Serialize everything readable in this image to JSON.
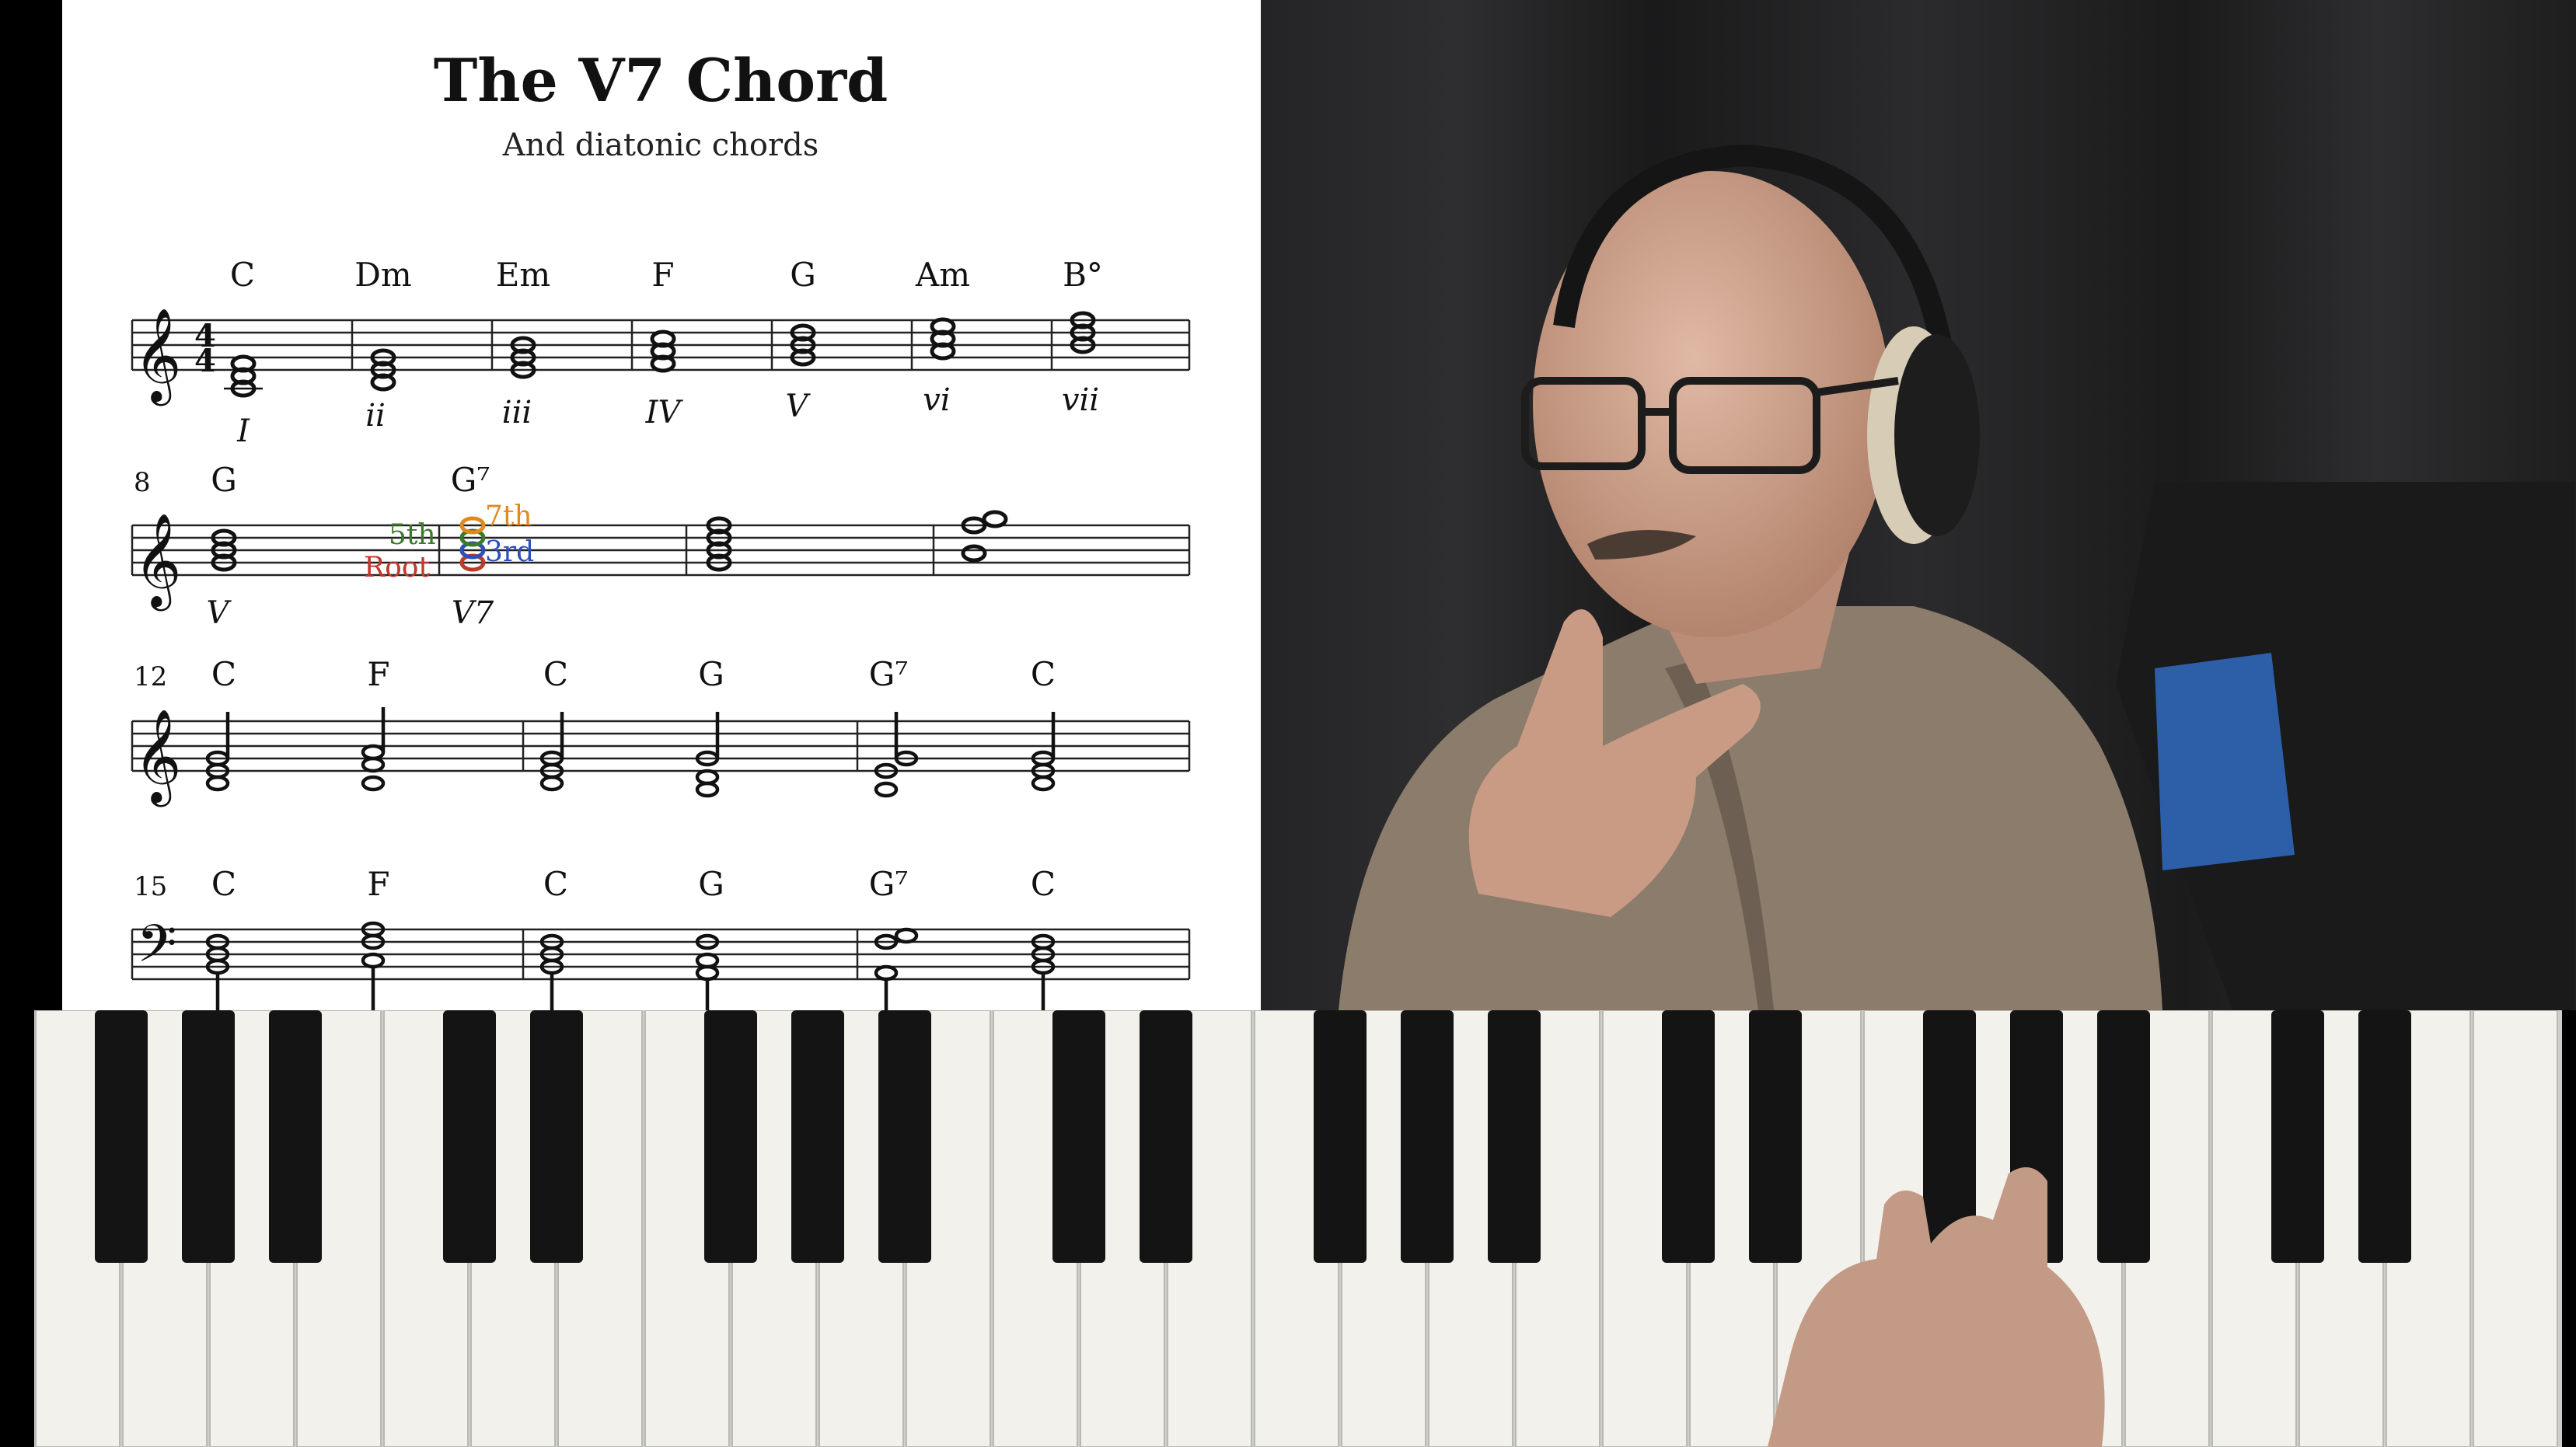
{
  "score": {
    "title": "The V7 Chord",
    "subtitle": "And diatonic chords",
    "systems": [
      {
        "measure_number": "",
        "clef": "treble",
        "time_signature": "4/4",
        "chords": [
          "C",
          "Dm",
          "Em",
          "F",
          "G",
          "Am",
          "B°"
        ],
        "numerals": [
          "I",
          "ii",
          "iii",
          "IV",
          "V",
          "vi",
          "vii"
        ]
      },
      {
        "measure_number": "8",
        "clef": "treble",
        "chords": [
          "G",
          "G⁷"
        ],
        "numerals": [
          "V",
          "V7"
        ],
        "annotations": {
          "root": {
            "text": "Root",
            "color": "#c0392b"
          },
          "fifth_left": {
            "text": "5th",
            "color": "#3b7a2a"
          },
          "seventh": {
            "text": "7th",
            "color": "#e08a1e"
          },
          "third": {
            "text": "3rd",
            "color": "#2c4fb8"
          }
        }
      },
      {
        "measure_number": "12",
        "clef": "treble",
        "chords": [
          "C",
          "F",
          "C",
          "G",
          "G⁷",
          "C"
        ]
      },
      {
        "measure_number": "15",
        "clef": "bass",
        "chords": [
          "C",
          "F",
          "C",
          "G",
          "G⁷",
          "C"
        ]
      }
    ]
  },
  "webcam": {
    "description_icon": "person-with-headphones-icon"
  },
  "keyboard": {
    "description_icon": "piano-keyboard-icon",
    "white_key_color": "#f2f1ec",
    "black_key_color": "#141414"
  }
}
